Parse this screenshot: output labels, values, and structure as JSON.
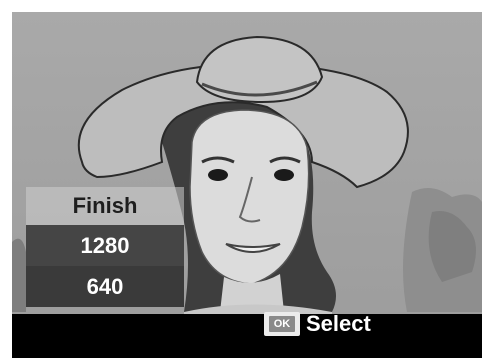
{
  "menu": {
    "title": "Finish",
    "options": [
      "1280",
      "640"
    ]
  },
  "footer": {
    "ok_key": "OK",
    "select_label": "Select"
  },
  "icons": {
    "ok_key": "ok-button-icon"
  }
}
